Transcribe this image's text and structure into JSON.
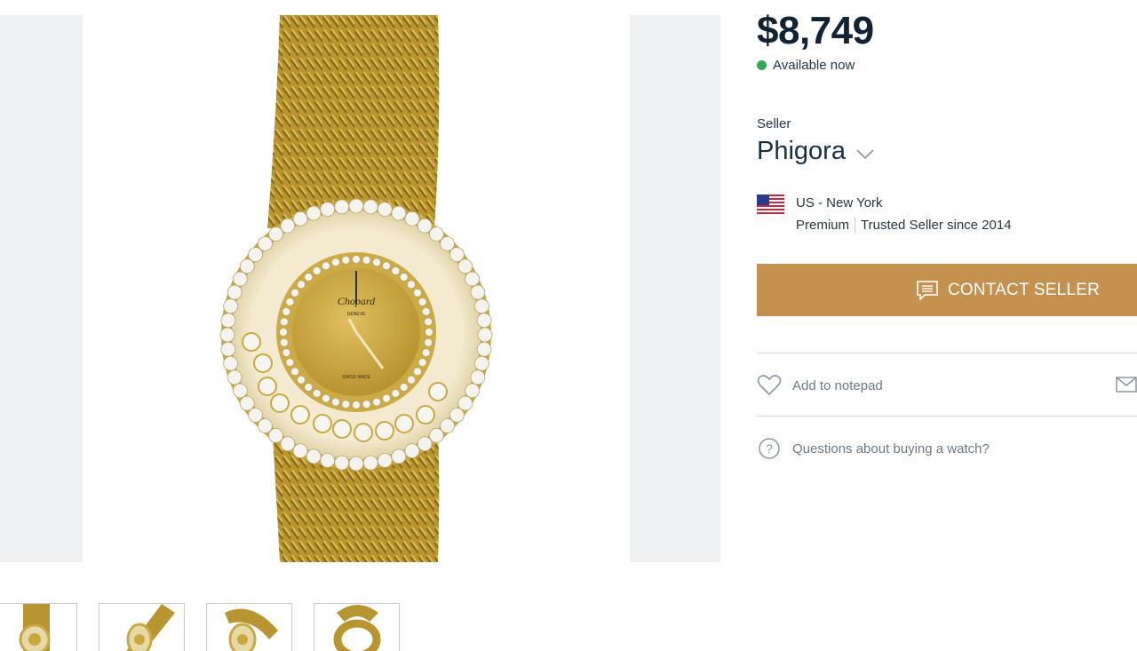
{
  "listing": {
    "price": "$8,749",
    "availability": "Available now"
  },
  "seller": {
    "caption": "Seller",
    "name": "Phigora",
    "location": "US - New York",
    "tier": "Premium",
    "trust": "Trusted Seller since 2014"
  },
  "actions": {
    "contact_label": "CONTACT SELLER",
    "notepad_label": "Add to notepad",
    "questions_label": "Questions about buying a watch?"
  },
  "gallery": {
    "dial_brand": "Chopard",
    "dial_city": "GENEVE",
    "dial_swiss": "SWISS MADE",
    "thumbnail_count": 4
  },
  "colors": {
    "accent": "#c4914f",
    "available": "#2eaa55",
    "text": "#173047",
    "muted": "#6c7a86"
  },
  "icons": [
    "chevron-down-icon",
    "us-flag-icon",
    "chat-icon",
    "heart-icon",
    "mail-icon",
    "question-icon"
  ]
}
